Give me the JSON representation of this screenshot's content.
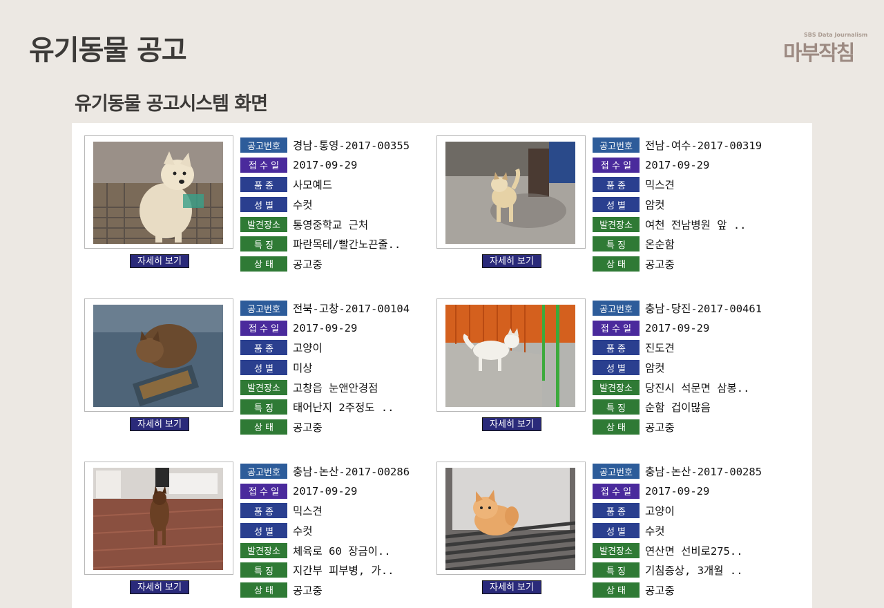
{
  "page_title": "유기동물 공고",
  "logo": {
    "small_text": "SBS Data Journalism",
    "main_text": "마부작침"
  },
  "subtitle": "유기동물 공고시스템 화면",
  "labels": {
    "notice_no": "공고번호",
    "received": "접 수 일",
    "breed": "품    종",
    "sex": "성    별",
    "found_at": "발견장소",
    "feature": "특    징",
    "status": "상    태",
    "detail_button": "자세히 보기"
  },
  "cards": [
    {
      "notice_no": "경남-통영-2017-00355",
      "received": "2017-09-29",
      "breed": "사모예드",
      "sex": "수컷",
      "found_at": "통영중학교 근처",
      "feature": "파란목테/빨간노끈줄..",
      "status": "공고중"
    },
    {
      "notice_no": "전남-여수-2017-00319",
      "received": "2017-09-29",
      "breed": "믹스견",
      "sex": "암컷",
      "found_at": "여천 전남병원 앞 ..",
      "feature": "온순함",
      "status": "공고중"
    },
    {
      "notice_no": "전북-고창-2017-00104",
      "received": "2017-09-29",
      "breed": "고양이",
      "sex": "미상",
      "found_at": "고창읍 눈앤안경점",
      "feature": "태어난지 2주정도 ..",
      "status": "공고중"
    },
    {
      "notice_no": "충남-당진-2017-00461",
      "received": "2017-09-29",
      "breed": "진도견",
      "sex": "암컷",
      "found_at": "당진시 석문면 삼봉..",
      "feature": "순함 겁이많음",
      "status": "공고중"
    },
    {
      "notice_no": "충남-논산-2017-00286",
      "received": "2017-09-29",
      "breed": "믹스견",
      "sex": "수컷",
      "found_at": "체육로 60 장금이..",
      "feature": "지간부 피부병, 가..",
      "status": "공고중"
    },
    {
      "notice_no": "충남-논산-2017-00285",
      "received": "2017-09-29",
      "breed": "고양이",
      "sex": "수컷",
      "found_at": "연산면 선비로275..",
      "feature": "기침증상, 3개월 ..",
      "status": "공고중"
    }
  ]
}
